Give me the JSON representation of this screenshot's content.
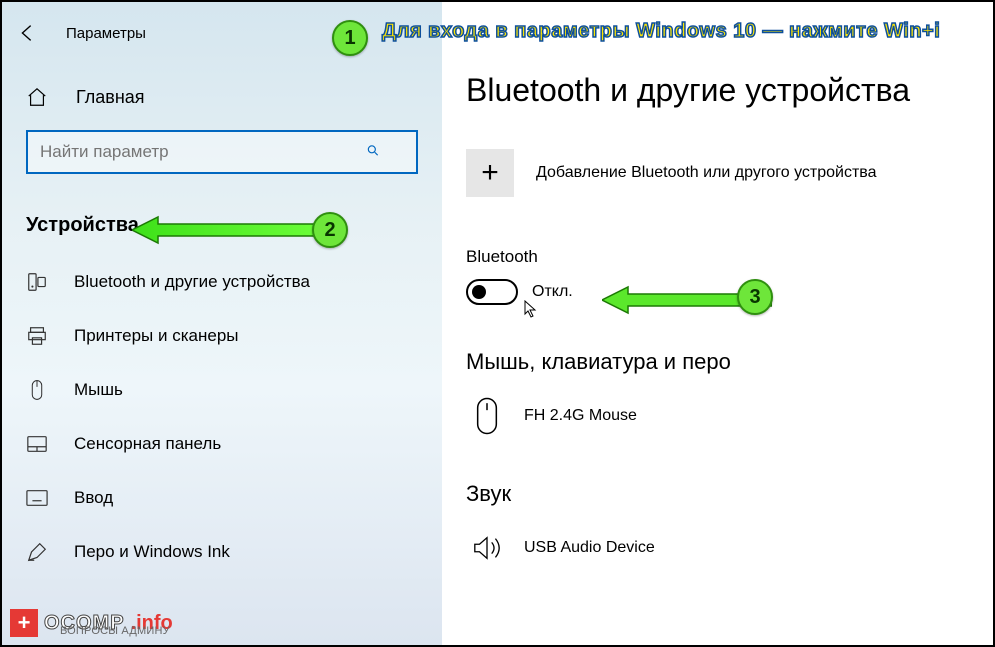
{
  "header": {
    "title": "Параметры"
  },
  "home": {
    "label": "Главная"
  },
  "search": {
    "placeholder": "Найти параметр"
  },
  "category": {
    "label": "Устройства"
  },
  "nav": [
    {
      "icon": "bluetooth",
      "label": "Bluetooth и другие устройства"
    },
    {
      "icon": "printer",
      "label": "Принтеры и сканеры"
    },
    {
      "icon": "mouse",
      "label": "Мышь"
    },
    {
      "icon": "touchpad",
      "label": "Сенсорная панель"
    },
    {
      "icon": "keyboard",
      "label": "Ввод"
    },
    {
      "icon": "pen",
      "label": "Перо и Windows Ink"
    }
  ],
  "main": {
    "title": "Bluetooth и другие устройства",
    "add_label": "Добавление Bluetooth или другого устройства",
    "bt_section": "Bluetooth",
    "bt_toggle_state": "Откл.",
    "mouse_heading": "Мышь, клавиатура и перо",
    "mouse_device": "FH 2.4G Mouse",
    "audio_heading": "Звук",
    "audio_device": "USB Audio Device"
  },
  "annotations": {
    "hint1": "Для входа в параметры Windows 10 — нажмите Win+i",
    "badges": [
      "1",
      "2",
      "3"
    ]
  },
  "watermark": {
    "main": "OCOMP",
    "suffix": ".info",
    "sub": "ВОПРОСЫ АДМИНУ"
  }
}
